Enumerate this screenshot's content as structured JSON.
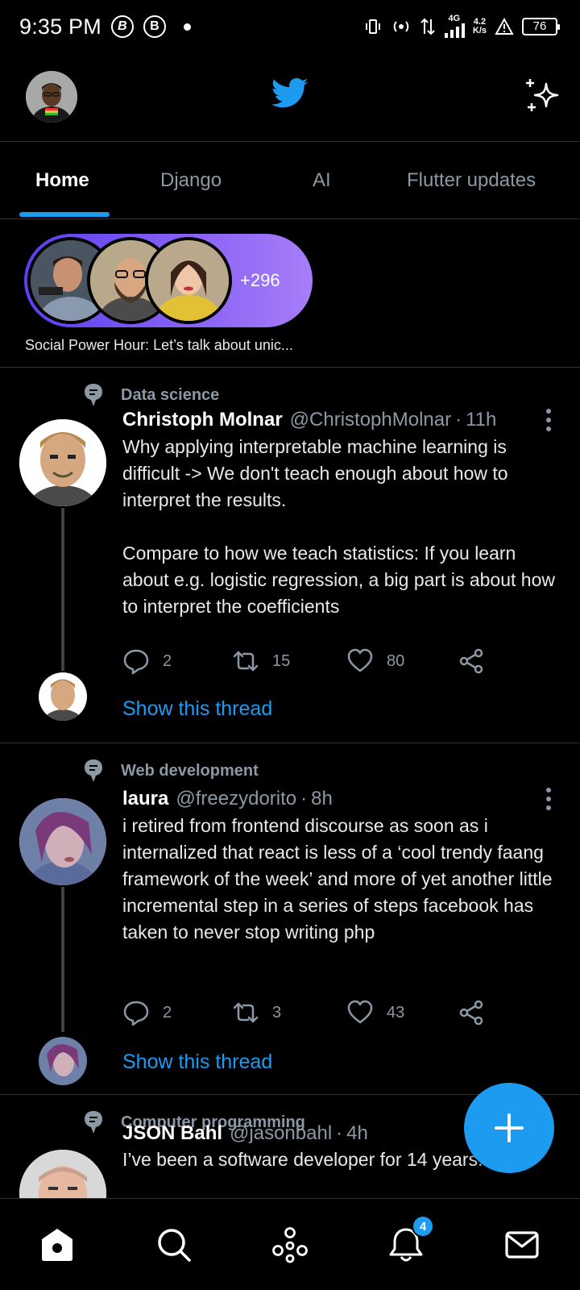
{
  "status_bar": {
    "time": "9:35 PM",
    "badge_1": "B",
    "badge_2": "B",
    "network_type": "4G",
    "speed_value": "4.2",
    "speed_unit": "K/s",
    "battery": "76"
  },
  "app_bar": {
    "logo_icon": "bird-icon",
    "right_icon": "sparkle-icon"
  },
  "tabs": [
    {
      "label": "Home",
      "active": true
    },
    {
      "label": "Django",
      "active": false
    },
    {
      "label": "AI",
      "active": false
    },
    {
      "label": "Flutter updates",
      "active": false
    }
  ],
  "space": {
    "count": "+296",
    "title": "Social Power Hour: Let’s talk about unic..."
  },
  "tweets": [
    {
      "topic": "Data science",
      "name": "Christoph Molnar",
      "handle": "@ChristophMolnar",
      "separator": "·",
      "time": "11h",
      "text": "Why applying interpretable machine learning is difficult -> We don't teach enough about how to interpret the results.\n\nCompare to how we teach statistics: If you learn about e.g. logistic regression, a big part is about how to interpret the coefficients",
      "replies": "2",
      "retweets": "15",
      "likes": "80",
      "show_thread": "Show this thread"
    },
    {
      "topic": "Web development",
      "name": "laura",
      "handle": "@freezydorito",
      "separator": "·",
      "time": "8h",
      "text": "i retired from frontend discourse as soon as i internalized that react is less of a ‘cool trendy faang framework of the week’ and more of yet another little incremental step in a series of steps facebook has taken to never stop writing php",
      "replies": "2",
      "retweets": "3",
      "likes": "43",
      "show_thread": "Show this thread"
    },
    {
      "topic": "Computer programming",
      "name": "JSON Bahl",
      "handle": "@jasonbahl",
      "separator": "·",
      "time": "4h",
      "text": "I’ve been a software developer for 14 years."
    }
  ],
  "bottom_nav": {
    "items": [
      "home-icon",
      "search-icon",
      "communities-icon",
      "notifications-icon",
      "messages-icon"
    ],
    "notification_count": "4"
  },
  "colors": {
    "accent": "#1d9bf0",
    "background": "#000000",
    "secondary_text": "#8b98a5",
    "divider": "#2f3336"
  }
}
